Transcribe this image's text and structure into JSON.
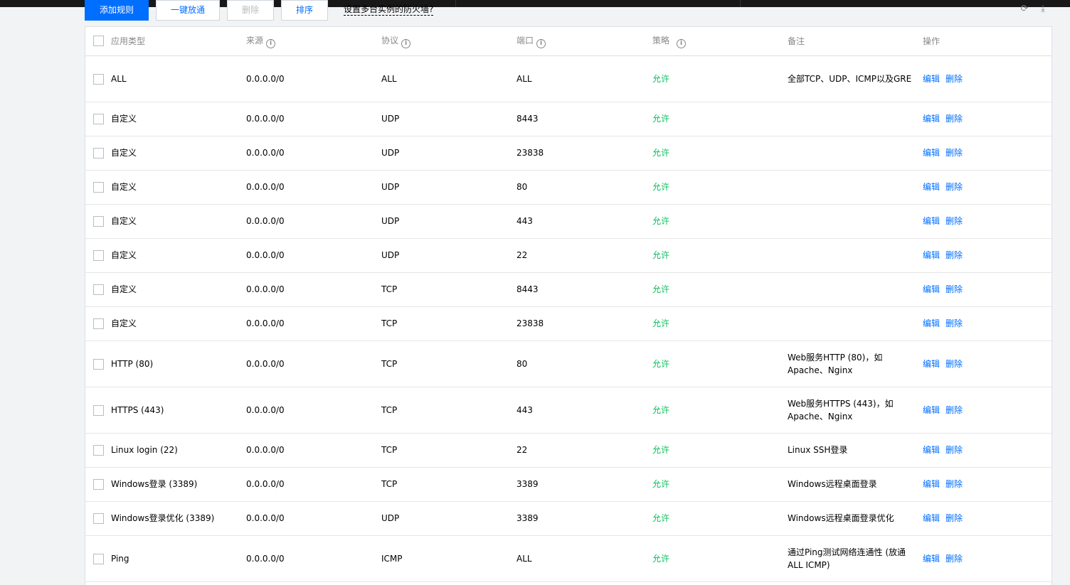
{
  "toolbar": {
    "add_rule": "添加规则",
    "one_click_open": "一键放通",
    "delete": "删除",
    "sort": "排序",
    "help_link": "设置多台实例的防火墙?",
    "refresh_icon": "refresh-icon",
    "download_icon": "download-icon"
  },
  "table": {
    "headers": {
      "type": "应用类型",
      "source": "来源",
      "protocol": "协议",
      "port": "端口",
      "policy": "策略",
      "note": "备注",
      "ops": "操作"
    },
    "edit_label": "编辑",
    "delete_label": "删除",
    "rows": [
      {
        "type": "ALL",
        "source": "0.0.0.0/0",
        "protocol": "ALL",
        "port": "ALL",
        "policy": "允许",
        "note": "全部TCP、UDP、ICMP以及GRE"
      },
      {
        "type": "自定义",
        "source": "0.0.0.0/0",
        "protocol": "UDP",
        "port": "8443",
        "policy": "允许",
        "note": ""
      },
      {
        "type": "自定义",
        "source": "0.0.0.0/0",
        "protocol": "UDP",
        "port": "23838",
        "policy": "允许",
        "note": ""
      },
      {
        "type": "自定义",
        "source": "0.0.0.0/0",
        "protocol": "UDP",
        "port": "80",
        "policy": "允许",
        "note": ""
      },
      {
        "type": "自定义",
        "source": "0.0.0.0/0",
        "protocol": "UDP",
        "port": "443",
        "policy": "允许",
        "note": ""
      },
      {
        "type": "自定义",
        "source": "0.0.0.0/0",
        "protocol": "UDP",
        "port": "22",
        "policy": "允许",
        "note": ""
      },
      {
        "type": "自定义",
        "source": "0.0.0.0/0",
        "protocol": "TCP",
        "port": "8443",
        "policy": "允许",
        "note": ""
      },
      {
        "type": "自定义",
        "source": "0.0.0.0/0",
        "protocol": "TCP",
        "port": "23838",
        "policy": "允许",
        "note": ""
      },
      {
        "type": "HTTP (80)",
        "source": "0.0.0.0/0",
        "protocol": "TCP",
        "port": "80",
        "policy": "允许",
        "note": "Web服务HTTP (80)，如Apache、Nginx"
      },
      {
        "type": "HTTPS (443)",
        "source": "0.0.0.0/0",
        "protocol": "TCP",
        "port": "443",
        "policy": "允许",
        "note": "Web服务HTTPS (443)，如Apache、Nginx"
      },
      {
        "type": "Linux login (22)",
        "source": "0.0.0.0/0",
        "protocol": "TCP",
        "port": "22",
        "policy": "允许",
        "note": "Linux SSH登录"
      },
      {
        "type": "Windows登录 (3389)",
        "source": "0.0.0.0/0",
        "protocol": "TCP",
        "port": "3389",
        "policy": "允许",
        "note": "Windows远程桌面登录"
      },
      {
        "type": "Windows登录优化 (3389)",
        "source": "0.0.0.0/0",
        "protocol": "UDP",
        "port": "3389",
        "policy": "允许",
        "note": "Windows远程桌面登录优化"
      },
      {
        "type": "Ping",
        "source": "0.0.0.0/0",
        "protocol": "ICMP",
        "port": "ALL",
        "policy": "允许",
        "note": "通过Ping测试网络连通性 (放通ALL ICMP)"
      }
    ]
  },
  "colors": {
    "primary": "#006eff",
    "allow": "#0abf5b"
  }
}
